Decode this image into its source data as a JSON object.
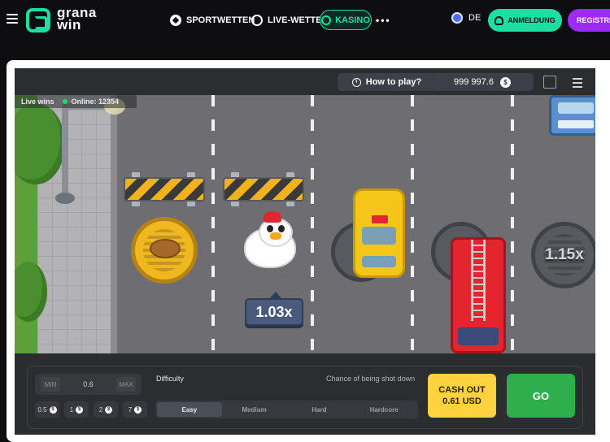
{
  "nav": {
    "logo_line1": "grana",
    "logo_line2": "win",
    "sportwetten": "SPORTWETTEN",
    "live_wetten": "LIVE-WETTEN",
    "kasino": "KASINO",
    "more": "•••",
    "language": "DE",
    "login": "ANMELDUNG",
    "register": "REGISTRIE"
  },
  "game": {
    "how_to_play": "How to play?",
    "balance": "999 997.6",
    "currency_icon": "$",
    "live_wins": "Live wins",
    "online": "Online: 12354",
    "current_multiplier": "1.03x",
    "next_multiplier": "1.15x"
  },
  "controls": {
    "min_label": "MIN",
    "bet_value": "0.6",
    "max_label": "MAX",
    "quick_bets": [
      "0.5",
      "1",
      "2",
      "7"
    ],
    "difficulty_label": "Difficulty",
    "chance_label": "Chance of being shot down",
    "difficulties": [
      "Easy",
      "Medium",
      "Hard",
      "Hardcore"
    ],
    "selected_difficulty": "Easy",
    "cashout_label": "CASH OUT",
    "cashout_amount": "0.61 USD",
    "go_label": "GO"
  },
  "colors": {
    "brand_green": "#19e0a0",
    "register_purple": "#9b2bff",
    "cashout_yellow": "#ffd23f",
    "go_green": "#2fae4e"
  }
}
